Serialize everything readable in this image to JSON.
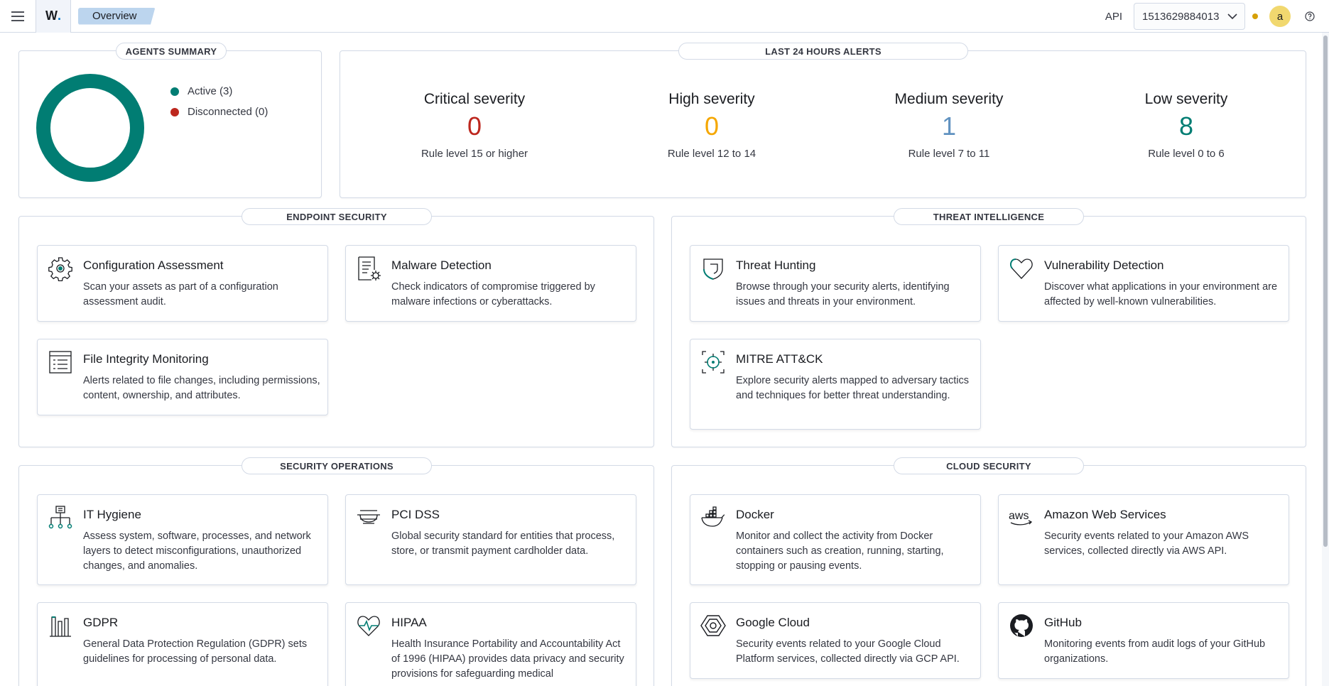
{
  "header": {
    "logo_letter": "W",
    "logo_dot": ".",
    "breadcrumb": "Overview",
    "api_label": "API",
    "api_value": "1513629884013",
    "avatar_initial": "a"
  },
  "agents_summary": {
    "title": "AGENTS SUMMARY",
    "legend": [
      {
        "label": "Active (3)",
        "color": "#017d73"
      },
      {
        "label": "Disconnected (0)",
        "color": "#bd271e"
      }
    ]
  },
  "alerts": {
    "title": "LAST 24 HOURS ALERTS",
    "items": [
      {
        "title": "Critical severity",
        "value": "0",
        "desc": "Rule level 15 or higher",
        "color": "#bd271e"
      },
      {
        "title": "High severity",
        "value": "0",
        "desc": "Rule level 12 to 14",
        "color": "#f5a700"
      },
      {
        "title": "Medium severity",
        "value": "1",
        "desc": "Rule level 7 to 11",
        "color": "#6092c0"
      },
      {
        "title": "Low severity",
        "value": "8",
        "desc": "Rule level 0 to 6",
        "color": "#017d73"
      }
    ]
  },
  "endpoint_security": {
    "title": "ENDPOINT SECURITY",
    "cards": [
      {
        "icon": "gear-icon",
        "title": "Configuration Assessment",
        "desc": "Scan your assets as part of a configuration assessment audit."
      },
      {
        "icon": "malware-document-icon",
        "title": "Malware Detection",
        "desc": "Check indicators of compromise triggered by malware infections or cyberattacks."
      },
      {
        "icon": "list-document-icon",
        "title": "File Integrity Monitoring",
        "desc": "Alerts related to file changes, including permissions, content, ownership, and attributes."
      }
    ]
  },
  "threat_intelligence": {
    "title": "THREAT INTELLIGENCE",
    "cards": [
      {
        "icon": "shield-icon",
        "title": "Threat Hunting",
        "desc": "Browse through your security alerts, identifying issues and threats in your environment."
      },
      {
        "icon": "heart-icon",
        "title": "Vulnerability Detection",
        "desc": "Discover what applications in your environment are affected by well-known vulnerabilities."
      },
      {
        "icon": "crosshair-icon",
        "title": "MITRE ATT&CK",
        "desc": "Explore security alerts mapped to adversary tactics and techniques for better threat understanding."
      }
    ]
  },
  "security_operations": {
    "title": "SECURITY OPERATIONS",
    "cards": [
      {
        "icon": "network-icon",
        "title": "IT Hygiene",
        "desc": "Assess system, software, processes, and network layers to detect misconfigurations, unauthorized changes, and anomalies."
      },
      {
        "icon": "card-lines-icon",
        "title": "PCI DSS",
        "desc": "Global security standard for entities that process, store, or transmit payment cardholder data."
      },
      {
        "icon": "columns-icon",
        "title": "GDPR",
        "desc": "General Data Protection Regulation (GDPR) sets guidelines for processing of personal data."
      },
      {
        "icon": "heartbeat-icon",
        "title": "HIPAA",
        "desc": "Health Insurance Portability and Accountability Act of 1996 (HIPAA) provides data privacy and security provisions for safeguarding medical"
      }
    ]
  },
  "cloud_security": {
    "title": "CLOUD SECURITY",
    "cards": [
      {
        "icon": "docker-icon",
        "title": "Docker",
        "desc": "Monitor and collect the activity from Docker containers such as creation, running, starting, stopping or pausing events."
      },
      {
        "icon": "aws-icon",
        "icon_text": "aws",
        "title": "Amazon Web Services",
        "desc": "Security events related to your Amazon AWS services, collected directly via AWS API."
      },
      {
        "icon": "google-cloud-icon",
        "title": "Google Cloud",
        "desc": "Security events related to your Google Cloud Platform services, collected directly via GCP API."
      },
      {
        "icon": "github-icon",
        "title": "GitHub",
        "desc": "Monitoring events from audit logs of your GitHub organizations."
      }
    ]
  }
}
